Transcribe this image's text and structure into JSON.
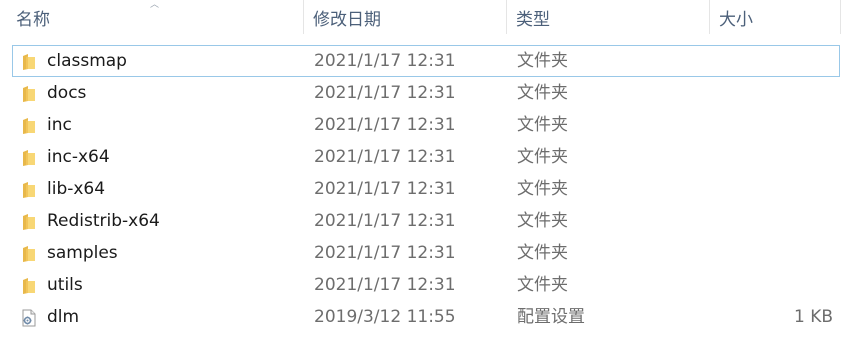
{
  "header": {
    "name": "名称",
    "date_modified": "修改日期",
    "type": "类型",
    "size": "大小"
  },
  "files": [
    {
      "name": "classmap",
      "date": "2021/1/17 12:31",
      "type": "文件夹",
      "size": "",
      "icon": "folder-icon"
    },
    {
      "name": "docs",
      "date": "2021/1/17 12:31",
      "type": "文件夹",
      "size": "",
      "icon": "folder-icon"
    },
    {
      "name": "inc",
      "date": "2021/1/17 12:31",
      "type": "文件夹",
      "size": "",
      "icon": "folder-icon"
    },
    {
      "name": "inc-x64",
      "date": "2021/1/17 12:31",
      "type": "文件夹",
      "size": "",
      "icon": "folder-icon"
    },
    {
      "name": "lib-x64",
      "date": "2021/1/17 12:31",
      "type": "文件夹",
      "size": "",
      "icon": "folder-icon"
    },
    {
      "name": "Redistrib-x64",
      "date": "2021/1/17 12:31",
      "type": "文件夹",
      "size": "",
      "icon": "folder-icon"
    },
    {
      "name": "samples",
      "date": "2021/1/17 12:31",
      "type": "文件夹",
      "size": "",
      "icon": "folder-icon"
    },
    {
      "name": "utils",
      "date": "2021/1/17 12:31",
      "type": "文件夹",
      "size": "",
      "icon": "folder-icon"
    },
    {
      "name": "dlm",
      "date": "2019/3/12 11:55",
      "type": "配置设置",
      "size": "1 KB",
      "icon": "config-file-icon"
    }
  ],
  "colors": {
    "header_text": "#4c607a",
    "folder_yellow": "#f8d775",
    "focus_border": "#99c8e8",
    "secondary_text": "#6d6d6d"
  }
}
